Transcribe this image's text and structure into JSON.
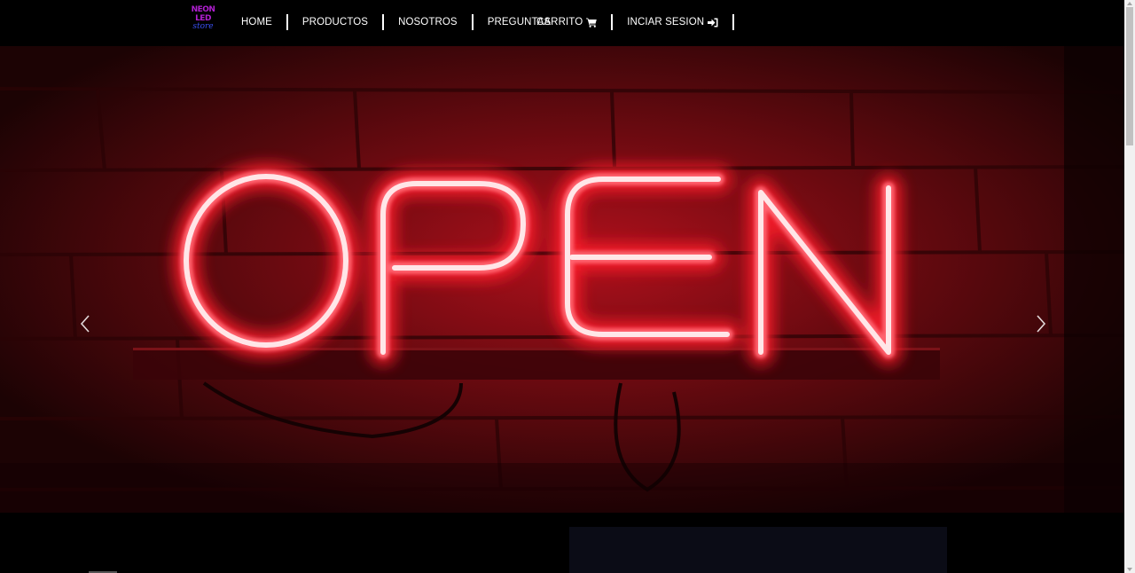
{
  "brand": {
    "logo_line1": "NEON",
    "logo_line2": "LED",
    "logo_line3": "store",
    "logo_colors": {
      "primary": "#b01fd0",
      "secondary": "#3a4ff0"
    }
  },
  "nav": {
    "items": [
      {
        "label": "HOME"
      },
      {
        "label": "PRODUCTOS"
      },
      {
        "label": "NOSOTROS"
      },
      {
        "label": "PREGUNTAS"
      }
    ],
    "cart": {
      "label": "CARRITO",
      "icon": "shopping-cart-icon"
    },
    "login": {
      "label": "INCIAR SESION",
      "icon": "sign-in-icon"
    }
  },
  "carousel": {
    "slide_sign_text": "OPEN",
    "prev_icon": "chevron-left-icon",
    "next_icon": "chevron-right-icon",
    "neon_color": "#ff2a3a"
  }
}
